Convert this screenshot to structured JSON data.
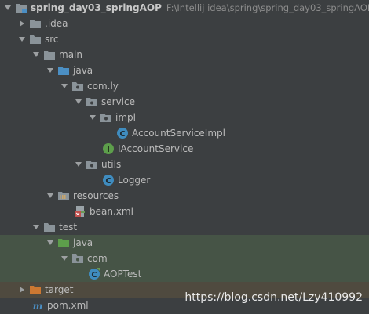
{
  "project": {
    "name": "spring_day03_springAOP",
    "path": "F:\\Intellij idea\\spring\\spring_day03_springAOP"
  },
  "tree": {
    "idea": ".idea",
    "src": "src",
    "main": "main",
    "java_main": "java",
    "com_ly": "com.ly",
    "service": "service",
    "impl": "impl",
    "account_service_impl": "AccountServiceImpl",
    "iaccount_service": "IAccountService",
    "utils": "utils",
    "logger": "Logger",
    "resources": "resources",
    "bean_xml": "bean.xml",
    "test": "test",
    "java_test": "java",
    "com": "com",
    "aop_test": "AOPTest",
    "target": "target",
    "pom_xml": "pom.xml"
  },
  "watermark": "https://blog.csdn.net/Lzy410992",
  "colors": {
    "background": "#3c3f41",
    "folder_grey": "#8a9399",
    "folder_blue": "#4b8fc4",
    "folder_orange": "#cc7832",
    "class_blue": "#3f8cbf",
    "interface_green": "#5d9e4b",
    "highlight_green": "#465446"
  }
}
